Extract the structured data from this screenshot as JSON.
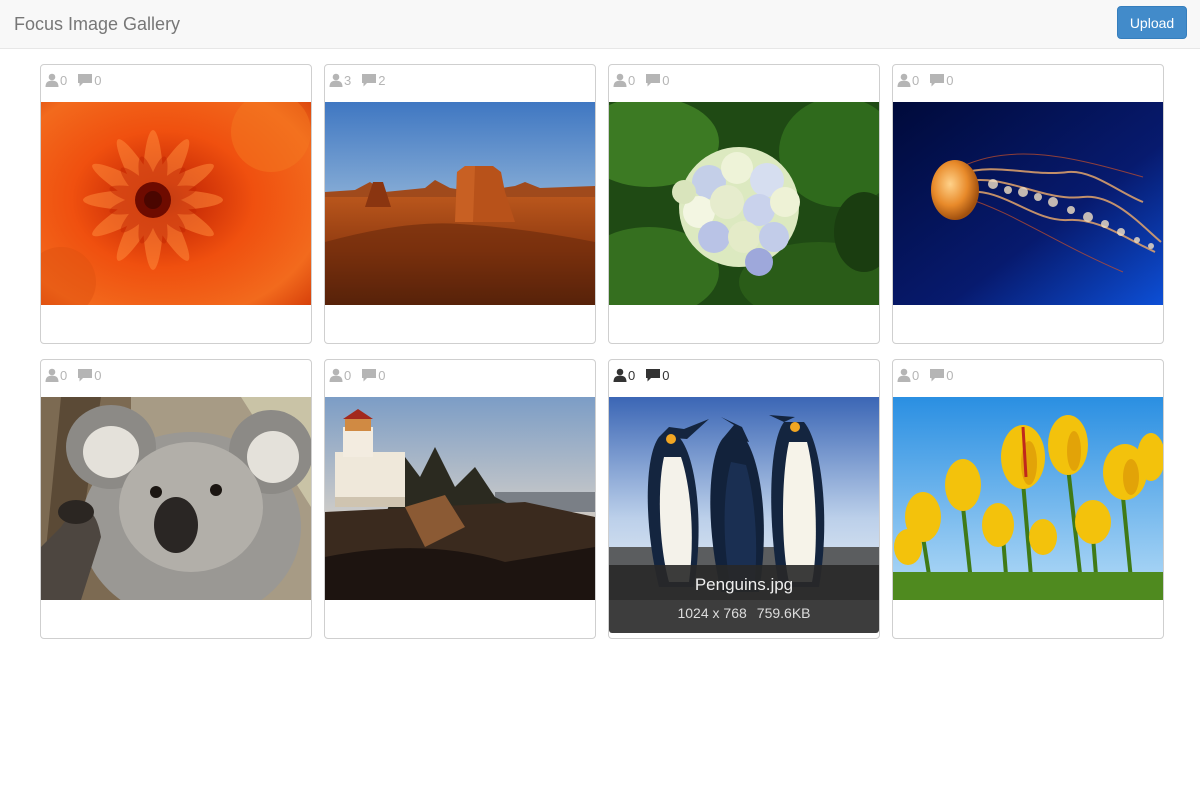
{
  "app": {
    "title": "Focus Image Gallery",
    "upload_label": "Upload"
  },
  "gallery": [
    {
      "name": "flower",
      "likes": "0",
      "comments": "0"
    },
    {
      "name": "desert",
      "likes": "3",
      "comments": "2"
    },
    {
      "name": "hydrangea",
      "likes": "0",
      "comments": "0"
    },
    {
      "name": "jellyfish",
      "likes": "0",
      "comments": "0"
    },
    {
      "name": "koala",
      "likes": "0",
      "comments": "0"
    },
    {
      "name": "lighthouse",
      "likes": "0",
      "comments": "0"
    },
    {
      "name": "penguins",
      "likes": "0",
      "comments": "0",
      "caption": "Penguins.jpg",
      "dimensions": "1024 x 768",
      "size": "759.6KB"
    },
    {
      "name": "tulips",
      "likes": "0",
      "comments": "0"
    }
  ],
  "colors": {
    "accent": "#428bca",
    "muted_icon": "#b5b5b5",
    "active_icon": "#333333"
  },
  "icons": {
    "likes": "user-icon",
    "comments": "comment-icon"
  }
}
